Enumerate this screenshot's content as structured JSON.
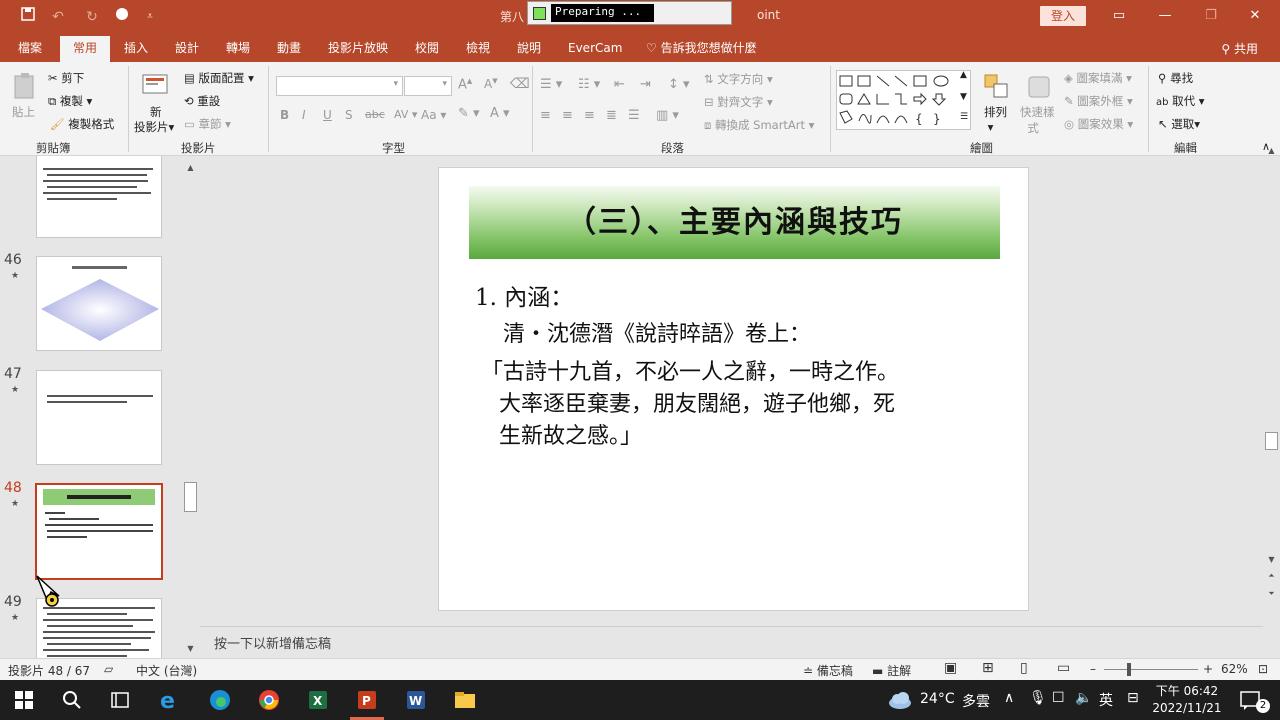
{
  "titlebar": {
    "title_left": "第八",
    "title_right": "oint",
    "popup_text": "Preparing ...",
    "signin": "登入"
  },
  "tabs": [
    "檔案",
    "常用",
    "插入",
    "設計",
    "轉場",
    "動畫",
    "投影片放映",
    "校閱",
    "檢視",
    "說明",
    "EverCam"
  ],
  "tell_me": "告訴我您想做什麼",
  "share": "共用",
  "ribbon": {
    "clipboard": {
      "paste": "貼上",
      "cut": "剪下",
      "copy": "複製",
      "format_painter": "複製格式",
      "label": "剪貼簿"
    },
    "slides": {
      "new_slide_1": "新",
      "new_slide_2": "投影片",
      "layout": "版面配置",
      "reset": "重設",
      "section": "章節",
      "label": "投影片"
    },
    "font": {
      "label": "字型"
    },
    "paragraph": {
      "text_direction": "文字方向",
      "align_text": "對齊文字",
      "smartart": "轉換成 SmartArt",
      "label": "段落"
    },
    "drawing": {
      "arrange": "排列",
      "quick_styles_1": "快速樣",
      "quick_styles_2": "式",
      "shape_fill": "圖案填滿",
      "shape_outline": "圖案外框",
      "shape_effects": "圖案效果",
      "label": "繪圖"
    },
    "editing": {
      "find": "尋找",
      "replace": "取代",
      "select": "選取",
      "label": "編輯"
    }
  },
  "thumbnails": [
    {
      "num": "46"
    },
    {
      "num": "47"
    },
    {
      "num": "48"
    },
    {
      "num": "49"
    }
  ],
  "slide": {
    "title": "（三）、主要內涵與技巧",
    "line1": "1.  內涵：",
    "line2": "清・沈德潛《說詩晬語》卷上：",
    "line3": "「古詩十九首，不必一人之辭，一時之作。",
    "line4": "大率逐臣棄妻，朋友闊絕，遊子他鄉，死",
    "line5": "生新故之感。」"
  },
  "notes_placeholder": "按一下以新增備忘稿",
  "statusbar": {
    "slide_count": "投影片 48 / 67",
    "language": "中文 (台灣)",
    "notes": "備忘稿",
    "comments": "註解",
    "zoom": "62%"
  },
  "taskbar": {
    "weather_temp": "24°C",
    "weather_desc": "多雲",
    "ime": "英",
    "time": "下午 06:42",
    "date": "2022/11/21",
    "notif_count": "2"
  },
  "colors": {
    "accent": "#b7472a",
    "selected_border": "#c43e1c",
    "banner_green": "#5aa83f"
  }
}
